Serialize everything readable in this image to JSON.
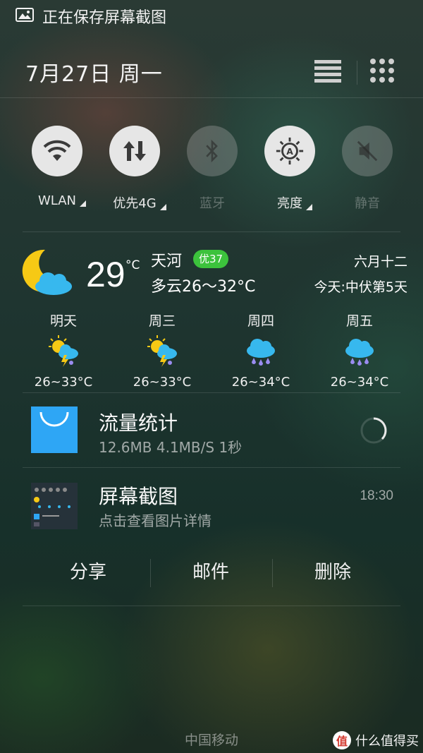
{
  "status_bar": {
    "icon": "image-icon",
    "text": "正在保存屏幕截图"
  },
  "header": {
    "date": "7月27日  周一",
    "settings_icon": "settings-list-icon",
    "apps_icon": "app-grid-icon"
  },
  "quick_toggles": [
    {
      "label": "WLAN",
      "icon": "wifi-icon",
      "state": "on",
      "has_more": true
    },
    {
      "label": "优先4G",
      "icon": "mobile-data-icon",
      "state": "on",
      "has_more": true
    },
    {
      "label": "蓝牙",
      "icon": "bluetooth-icon",
      "state": "off",
      "has_more": false
    },
    {
      "label": "亮度",
      "icon": "auto-brightness-icon",
      "state": "on",
      "has_more": true
    },
    {
      "label": "静音",
      "icon": "mute-icon",
      "state": "off",
      "has_more": false
    }
  ],
  "weather": {
    "icon": "moon-cloud-icon",
    "temperature": "29",
    "unit": "°C",
    "city": "天河",
    "aqi": "优37",
    "aqi_color": "#3cc23c",
    "condition": "多云26～32°C",
    "lunar_date": "六月十二",
    "solar_term": "今天:中伏第5天",
    "forecast": [
      {
        "day": "明天",
        "icon": "sun-thunder-rain-icon",
        "range": "26~33°C"
      },
      {
        "day": "周三",
        "icon": "sun-thunder-rain-icon",
        "range": "26~33°C"
      },
      {
        "day": "周四",
        "icon": "rain-cloud-icon",
        "range": "26~34°C"
      },
      {
        "day": "周五",
        "icon": "rain-cloud-icon",
        "range": "26~34°C"
      }
    ]
  },
  "notifications": [
    {
      "title": "流量统计",
      "subtitle": "12.6MB   4.1MB/S   1秒",
      "icon": "shopping-bag-icon",
      "accent": "#2ea6f5"
    },
    {
      "title": "屏幕截图",
      "subtitle": "点击查看图片详情",
      "time": "18:30",
      "icon": "screenshot-thumbnail",
      "actions": [
        "分享",
        "邮件",
        "删除"
      ]
    }
  ],
  "carrier": "中国移动",
  "watermark": {
    "badge": "值",
    "text": "什么值得买"
  }
}
